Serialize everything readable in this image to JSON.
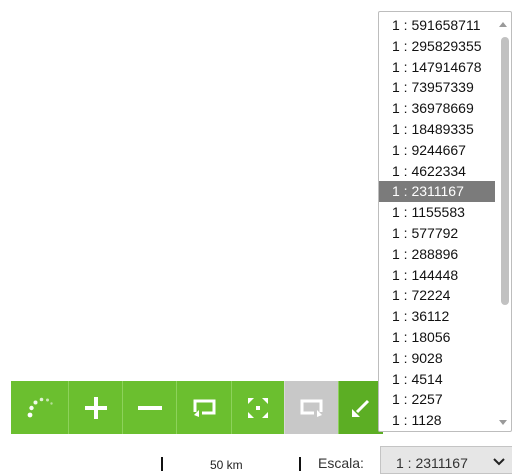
{
  "map_toolbar": {
    "tools": [
      {
        "name": "loading-spinner-icon"
      },
      {
        "name": "zoom-in-icon",
        "glyph": "+"
      },
      {
        "name": "zoom-out-icon",
        "glyph": "−"
      },
      {
        "name": "previous-extent-icon"
      },
      {
        "name": "full-extent-icon"
      },
      {
        "name": "next-extent-icon"
      },
      {
        "name": "collapse-icon"
      }
    ],
    "colors": {
      "active": "#6bbf2f",
      "disabled": "#c8c8c8"
    }
  },
  "scale_dropdown": {
    "options": [
      "1 : 591658711",
      "1 : 295829355",
      "1 : 147914678",
      "1 : 73957339",
      "1 : 36978669",
      "1 : 18489335",
      "1 : 9244667",
      "1 : 4622334",
      "1 : 2311167",
      "1 : 1155583",
      "1 : 577792",
      "1 : 288896",
      "1 : 144448",
      "1 : 72224",
      "1 : 36112",
      "1 : 18056",
      "1 : 9028",
      "1 : 4514",
      "1 : 2257",
      "1 : 1128"
    ],
    "selected_index": 8
  },
  "footer": {
    "scale_bar_label": "50 km",
    "scale_label": "Escala:",
    "scale_value": "1 : 2311167"
  }
}
